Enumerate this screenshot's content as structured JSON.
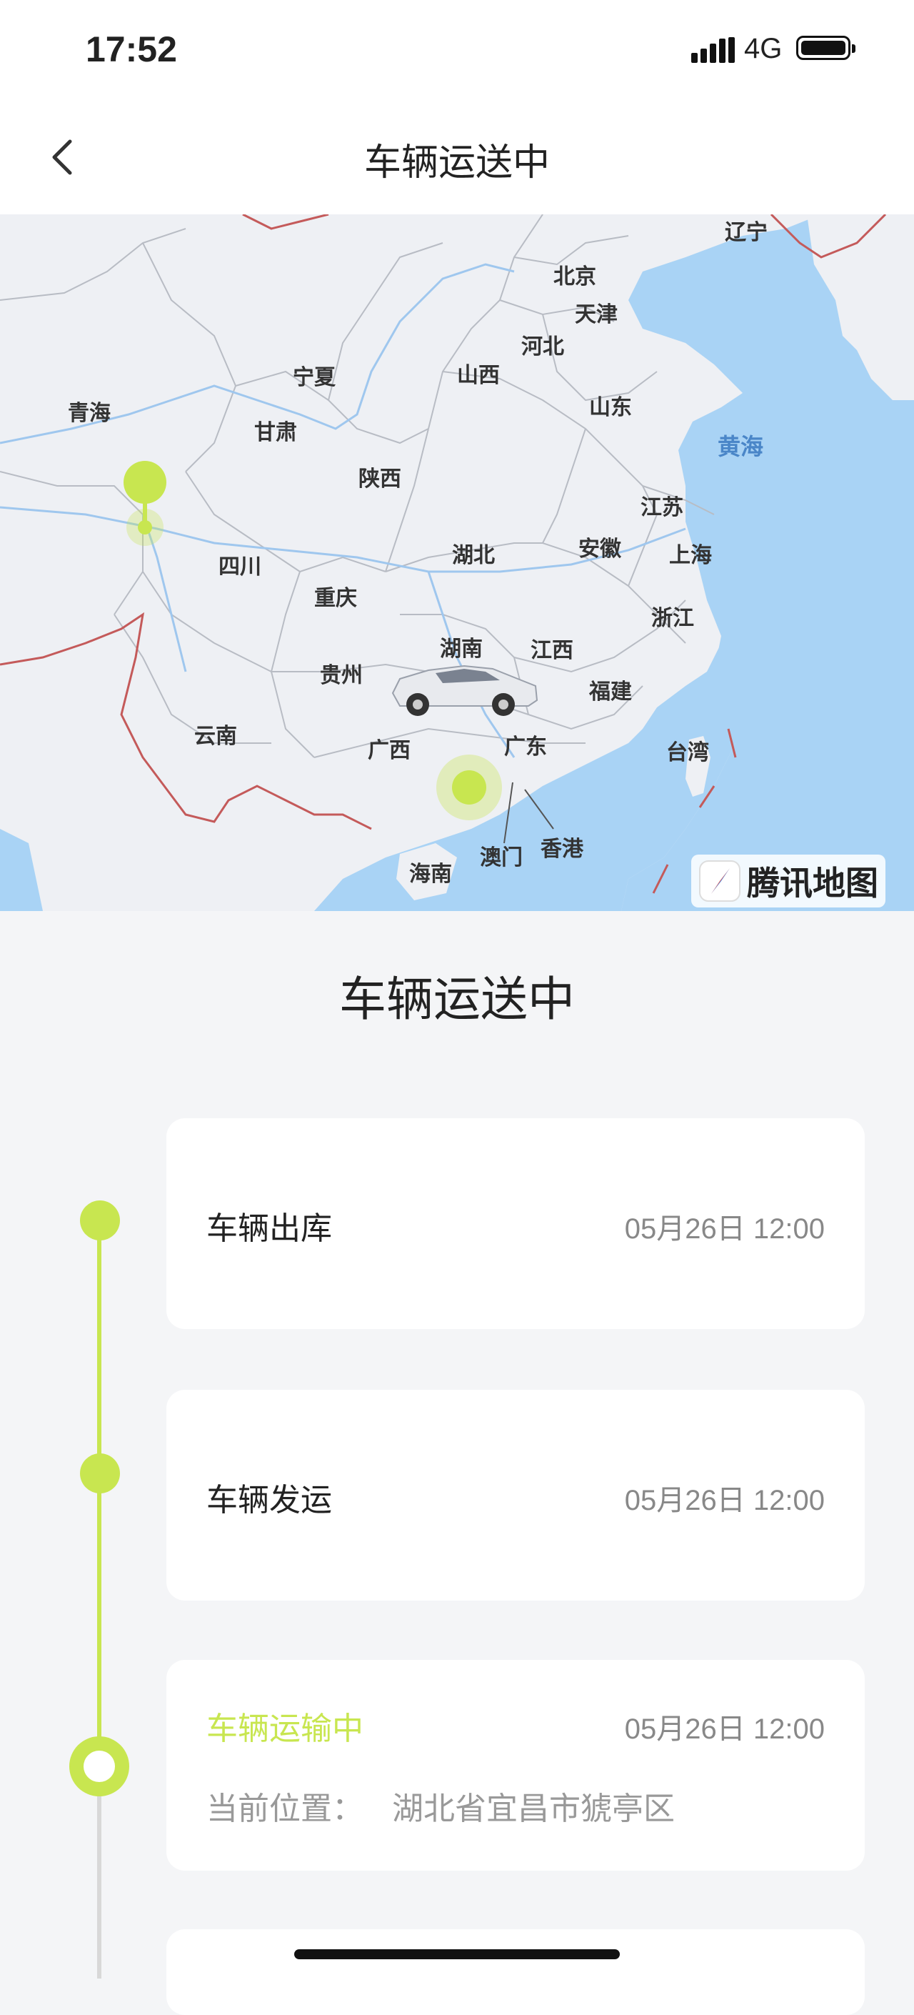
{
  "status_bar": {
    "time": "17:52",
    "network": "4G"
  },
  "nav": {
    "title": "车辆运送中",
    "back_icon": "chevron-left-icon"
  },
  "map": {
    "labels": {
      "liaoning": "辽宁",
      "beijing": "北京",
      "tianjin": "天津",
      "hebei": "河北",
      "shanxi": "山西",
      "shandong": "山东",
      "ningxia": "宁夏",
      "qinghai": "青海",
      "gansu": "甘肃",
      "shaanxi": "陕西",
      "huanghai": "黄海",
      "jiangsu": "江苏",
      "anhui": "安徽",
      "shanghai": "上海",
      "hubei": "湖北",
      "sichuan": "四川",
      "chongqing": "重庆",
      "zhejiang": "浙江",
      "hunan": "湖南",
      "jiangxi": "江西",
      "guizhou": "贵州",
      "fujian": "福建",
      "yunnan": "云南",
      "guangxi": "广西",
      "guangdong": "广东",
      "taiwan": "台湾",
      "macau": "澳门",
      "hongkong": "香港",
      "hainan": "海南"
    },
    "logo_text": "腾讯地图",
    "colors": {
      "land": "#eef0f4",
      "sea": "#a9d3f5",
      "accent": "#c8e650",
      "border": "#c45a5a"
    }
  },
  "section_title": "车辆运送中",
  "timeline": [
    {
      "label": "车辆出库",
      "time": "05月26日 12:00",
      "status": "done"
    },
    {
      "label": "车辆发运",
      "time": "05月26日 12:00",
      "status": "done"
    },
    {
      "label": "车辆运输中",
      "time": "05月26日 12:00",
      "status": "current",
      "location_label": "当前位置：",
      "location_value": "湖北省宜昌市猇亭区"
    }
  ]
}
